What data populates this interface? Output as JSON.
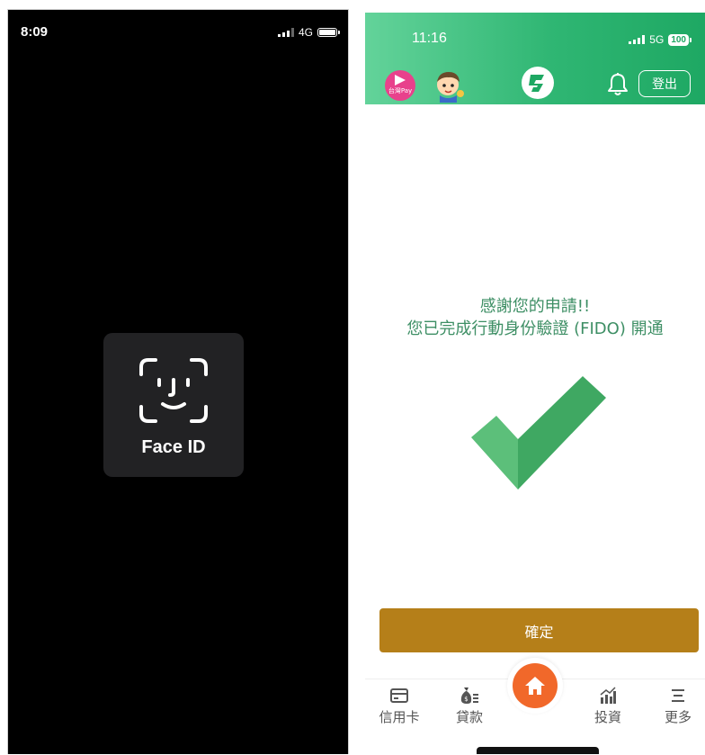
{
  "left_screen": {
    "time": "8:09",
    "network": "4G",
    "face_id_label": "Face ID",
    "icon": "face-id-icon"
  },
  "right_screen": {
    "time": "11:16",
    "network": "5G",
    "battery": "100",
    "header": {
      "pay_label": "台灣Pay",
      "logout_label": "登出",
      "icons": [
        "taiwan-pay-icon",
        "mascot-icon",
        "bank-logo-icon",
        "bell-icon"
      ]
    },
    "message": {
      "line1": "感謝您的申請!!",
      "line2": "您已完成行動身份驗證 (FIDO) 開通"
    },
    "confirm_label": "確定",
    "tabs": [
      {
        "label": "信用卡",
        "icon": "credit-card-icon"
      },
      {
        "label": "貸款",
        "icon": "loan-bag-icon"
      },
      {
        "label": "",
        "icon": "home-icon"
      },
      {
        "label": "投資",
        "icon": "investment-chart-icon"
      },
      {
        "label": "更多",
        "icon": "menu-icon"
      }
    ],
    "colors": {
      "header_green": "#2fb673",
      "check_green": "#4caf6e",
      "confirm_gold": "#b57f19",
      "home_orange": "#f1682a",
      "message_green": "#3e8f65"
    }
  }
}
